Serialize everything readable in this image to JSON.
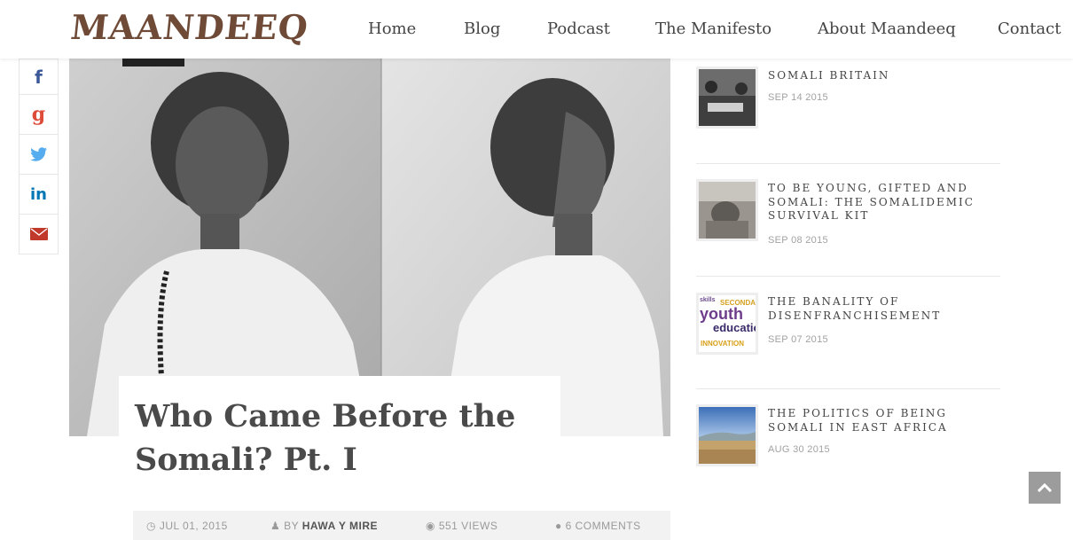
{
  "site": {
    "logo": "MAANDEEQ"
  },
  "nav": {
    "items": [
      {
        "label": "Home"
      },
      {
        "label": "Blog"
      },
      {
        "label": "Podcast"
      },
      {
        "label": "The Manifesto"
      },
      {
        "label": "About Maandeeq"
      },
      {
        "label": "Contact"
      }
    ]
  },
  "share": {
    "facebook": "f",
    "google": "g",
    "linkedin": "in",
    "icons": [
      "facebook-icon",
      "google-plus-icon",
      "twitter-icon",
      "linkedin-icon",
      "email-icon"
    ]
  },
  "article": {
    "title": "Who Came Before the Somali? Pt. I",
    "date": "JUL 01, 2015",
    "by_prefix": "BY",
    "author": "HAWA Y MIRE",
    "views": "551 VIEWS",
    "comments": "6 COMMENTS"
  },
  "sidebar": {
    "posts": [
      {
        "title": "SOMALI BRITAIN",
        "date": "SEP 14 2015"
      },
      {
        "title": "TO BE YOUNG, GIFTED AND SOMALI: THE SOMALIDEMIC SURVIVAL KIT",
        "date": "SEP 08 2015"
      },
      {
        "title": "THE BANALITY OF DISENFRANCHISEMENT",
        "date": "SEP 07 2015"
      },
      {
        "title": "THE POLITICS OF BEING SOMALI IN EAST AFRICA",
        "date": "AUG 30 2015"
      }
    ],
    "wordcloud": [
      "youth",
      "education",
      "INNOVATION",
      "SECONDARY",
      "skills"
    ]
  },
  "colors": {
    "logo": "#6e4a37",
    "facebook": "#3b5998",
    "google": "#dd4b39",
    "twitter": "#55acee",
    "linkedin": "#0077b5",
    "email": "#c0392b"
  }
}
